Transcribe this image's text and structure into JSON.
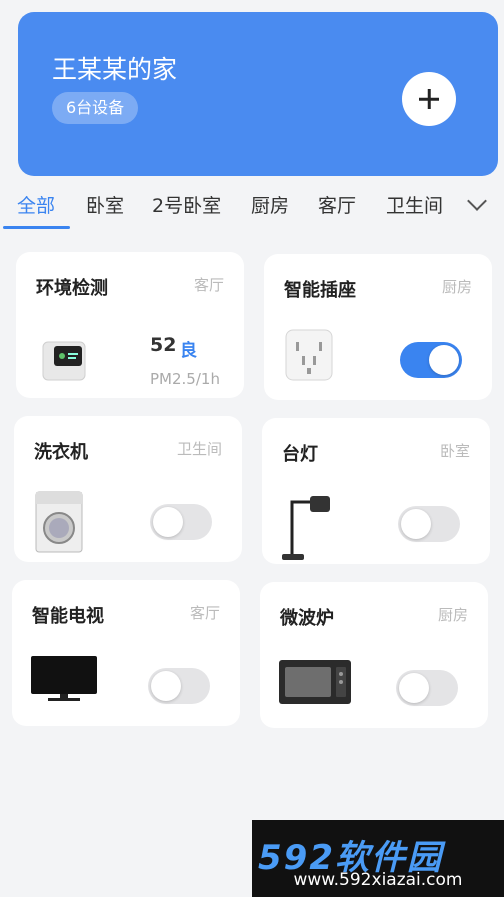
{
  "home": {
    "title": "王某某的家",
    "device_count": "6台设备"
  },
  "tabs": [
    "全部",
    "卧室",
    "2号卧室",
    "厨房",
    "客厅",
    "卫生间"
  ],
  "devices": [
    {
      "name": "环境检测",
      "room": "客厅",
      "aqi_value": "52",
      "aqi_level": "良",
      "aqi_unit": "PM2.5/1h"
    },
    {
      "name": "智能插座",
      "room": "厨房",
      "on": true
    },
    {
      "name": "洗衣机",
      "room": "卫生间",
      "on": false
    },
    {
      "name": "台灯",
      "room": "卧室",
      "on": false
    },
    {
      "name": "智能电视",
      "room": "客厅",
      "on": false
    },
    {
      "name": "微波炉",
      "room": "厨房",
      "on": false
    }
  ],
  "watermark": {
    "brand": "592软件园",
    "url": "www.592xiazai.com"
  },
  "colors": {
    "accent": "#3a84f0",
    "header": "#4a8bf0"
  }
}
